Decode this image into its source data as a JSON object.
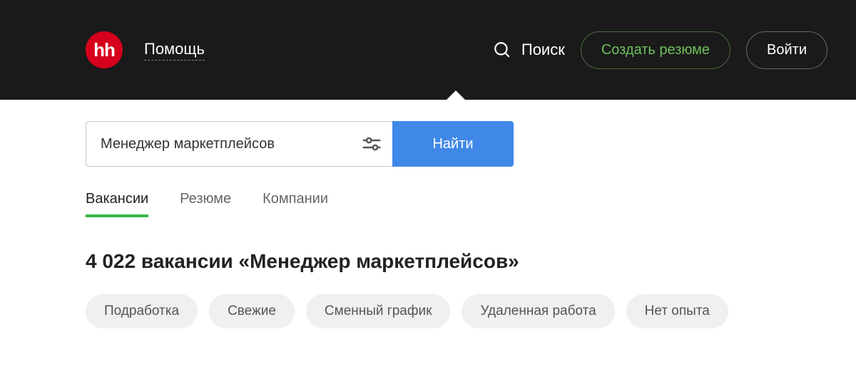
{
  "header": {
    "logo_text": "hh",
    "help_label": "Помощь",
    "search_label": "Поиск",
    "create_resume_label": "Создать резюме",
    "login_label": "Войти"
  },
  "search": {
    "value": "Менеджер маркетплейсов",
    "submit_label": "Найти"
  },
  "tabs": [
    {
      "label": "Вакансии",
      "active": true
    },
    {
      "label": "Резюме",
      "active": false
    },
    {
      "label": "Компании",
      "active": false
    }
  ],
  "results": {
    "heading": "4 022 вакансии «Менеджер маркетплейсов»"
  },
  "filters": [
    "Подработка",
    "Свежие",
    "Сменный график",
    "Удаленная работа",
    "Нет опыта"
  ]
}
